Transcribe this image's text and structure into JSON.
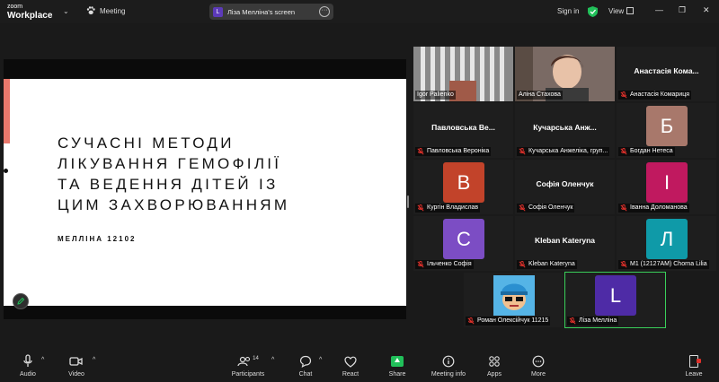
{
  "app": {
    "logo_top": "zoom",
    "logo_bottom": "Workplace",
    "meeting_label": "Meeting"
  },
  "share": {
    "avatar": "L",
    "label": "Ліза Мелліна's screen"
  },
  "titlebar": {
    "signin": "Sign in",
    "view": "View"
  },
  "slide": {
    "title_lines": [
      "Сучасні методи",
      "лікування гемофілії",
      "та ведення дітей із",
      "цим захворюванням"
    ],
    "author": "МЕЛЛІНА 12102"
  },
  "participants": [
    {
      "label": "Igor Palienko",
      "type": "video"
    },
    {
      "label": "Аліна Стахова",
      "type": "video"
    },
    {
      "big": "Анастасія Кома...",
      "label": "Анастасія Комариця"
    },
    {
      "big": "Павловська Ве...",
      "label": "Павловська Вероніка"
    },
    {
      "big": "Кучарська Анж...",
      "label": "Кучарська Анжеліка, груп..."
    },
    {
      "avatar": "Б",
      "avatar_color": "#a8786b",
      "label": "Богдан Нетеса"
    },
    {
      "avatar": "В",
      "avatar_color": "#c2432a",
      "label": "Кургін Владислав"
    },
    {
      "big": "Софія Оленчук",
      "label": "Софія Оленчук"
    },
    {
      "avatar": "І",
      "avatar_color": "#c0195f",
      "label": "Іванна Доломанова"
    },
    {
      "avatar": "С",
      "avatar_color": "#7c4dc4",
      "label": "Ільченко Софія"
    },
    {
      "big": "Kleban Kateryna",
      "label": "Kleban Kateryna"
    },
    {
      "avatar": "Л",
      "avatar_color": "#0f9aa8",
      "label": "М1 (12127AM) Chorna Lilia"
    },
    {
      "avatar": "",
      "avatar_color": "#55b4e6",
      "label": "Роман Олексійчук 11215"
    },
    {
      "avatar": "L",
      "avatar_color": "#4e2ba6",
      "label": "Ліза Мелліна"
    }
  ],
  "toolbar": {
    "audio": "Audio",
    "video": "Video",
    "participants": "Participants",
    "participants_count": "14",
    "chat": "Chat",
    "react": "React",
    "share": "Share",
    "meeting_info": "Meeting info",
    "apps": "Apps",
    "more": "More",
    "leave": "Leave"
  }
}
